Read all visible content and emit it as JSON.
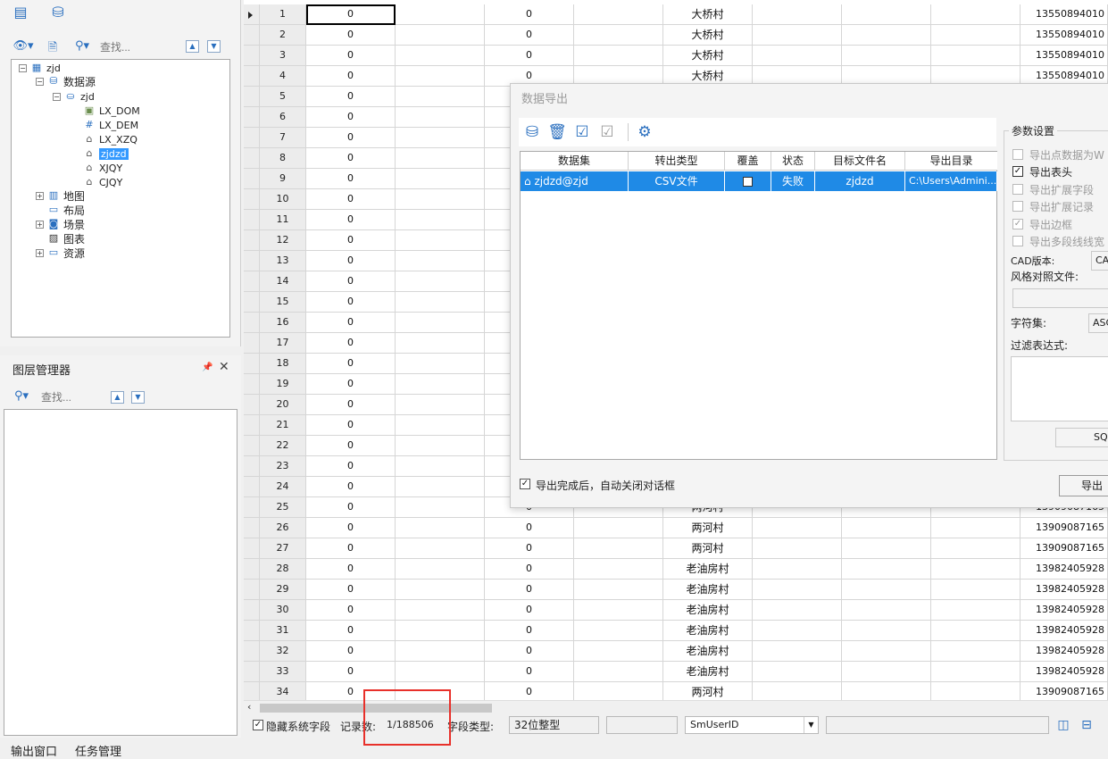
{
  "left_panel": {
    "search_placeholder": "查找...",
    "tree": {
      "root": "zjd",
      "datasource": "数据源",
      "db": "zjd",
      "datasets": [
        "LX_DOM",
        "LX_DEM",
        "LX_XZQ",
        "zjdzd",
        "XJQY",
        "CJQY"
      ],
      "selected": "zjdzd",
      "nodes": [
        "地图",
        "布局",
        "场景",
        "图表",
        "资源"
      ]
    }
  },
  "layer_manager": {
    "title": "图层管理器",
    "search_placeholder": "查找..."
  },
  "bottom_tabs": [
    "输出窗口",
    "任务管理"
  ],
  "grid": {
    "rows": [
      {
        "id": "1",
        "c1": "0",
        "c2": "0",
        "village": "大桥村",
        "phone": "13550894010"
      },
      {
        "id": "2",
        "c1": "0",
        "c2": "0",
        "village": "大桥村",
        "phone": "13550894010"
      },
      {
        "id": "3",
        "c1": "0",
        "c2": "0",
        "village": "大桥村",
        "phone": "13550894010"
      },
      {
        "id": "4",
        "c1": "0",
        "c2": "0",
        "village": "大桥村",
        "phone": "13550894010"
      },
      {
        "id": "5",
        "c1": "0",
        "c2": "",
        "village": "",
        "phone": ""
      },
      {
        "id": "6",
        "c1": "0",
        "c2": "",
        "village": "",
        "phone": ""
      },
      {
        "id": "7",
        "c1": "0",
        "c2": "",
        "village": "",
        "phone": ""
      },
      {
        "id": "8",
        "c1": "0",
        "c2": "",
        "village": "",
        "phone": ""
      },
      {
        "id": "9",
        "c1": "0",
        "c2": "",
        "village": "",
        "phone": ""
      },
      {
        "id": "10",
        "c1": "0",
        "c2": "",
        "village": "",
        "phone": ""
      },
      {
        "id": "11",
        "c1": "0",
        "c2": "",
        "village": "",
        "phone": ""
      },
      {
        "id": "12",
        "c1": "0",
        "c2": "",
        "village": "",
        "phone": ""
      },
      {
        "id": "13",
        "c1": "0",
        "c2": "",
        "village": "",
        "phone": ""
      },
      {
        "id": "14",
        "c1": "0",
        "c2": "",
        "village": "",
        "phone": ""
      },
      {
        "id": "15",
        "c1": "0",
        "c2": "",
        "village": "",
        "phone": ""
      },
      {
        "id": "16",
        "c1": "0",
        "c2": "",
        "village": "",
        "phone": ""
      },
      {
        "id": "17",
        "c1": "0",
        "c2": "",
        "village": "",
        "phone": ""
      },
      {
        "id": "18",
        "c1": "0",
        "c2": "",
        "village": "",
        "phone": ""
      },
      {
        "id": "19",
        "c1": "0",
        "c2": "",
        "village": "",
        "phone": ""
      },
      {
        "id": "20",
        "c1": "0",
        "c2": "",
        "village": "",
        "phone": ""
      },
      {
        "id": "21",
        "c1": "0",
        "c2": "",
        "village": "",
        "phone": ""
      },
      {
        "id": "22",
        "c1": "0",
        "c2": "",
        "village": "",
        "phone": ""
      },
      {
        "id": "23",
        "c1": "0",
        "c2": "",
        "village": "",
        "phone": ""
      },
      {
        "id": "24",
        "c1": "0",
        "c2": "",
        "village": "",
        "phone": ""
      },
      {
        "id": "25",
        "c1": "0",
        "c2": "0",
        "village": "两河村",
        "phone": "13909087165"
      },
      {
        "id": "26",
        "c1": "0",
        "c2": "0",
        "village": "两河村",
        "phone": "13909087165"
      },
      {
        "id": "27",
        "c1": "0",
        "c2": "0",
        "village": "两河村",
        "phone": "13909087165"
      },
      {
        "id": "28",
        "c1": "0",
        "c2": "0",
        "village": "老油房村",
        "phone": "13982405928"
      },
      {
        "id": "29",
        "c1": "0",
        "c2": "0",
        "village": "老油房村",
        "phone": "13982405928"
      },
      {
        "id": "30",
        "c1": "0",
        "c2": "0",
        "village": "老油房村",
        "phone": "13982405928"
      },
      {
        "id": "31",
        "c1": "0",
        "c2": "0",
        "village": "老油房村",
        "phone": "13982405928"
      },
      {
        "id": "32",
        "c1": "0",
        "c2": "0",
        "village": "老油房村",
        "phone": "13982405928"
      },
      {
        "id": "33",
        "c1": "0",
        "c2": "0",
        "village": "老油房村",
        "phone": "13982405928"
      },
      {
        "id": "34",
        "c1": "0",
        "c2": "0",
        "village": "两河村",
        "phone": "13909087165"
      }
    ]
  },
  "status_bar": {
    "hide_system_fields": "隐藏系统字段",
    "record_label": "记录数:",
    "record_value": "1/188506",
    "field_type_label": "字段类型:",
    "field_type_value": "32位整型",
    "field_name": "SmUserID"
  },
  "dialog": {
    "title": "数据导出",
    "table_headers": [
      "数据集",
      "转出类型",
      "覆盖",
      "状态",
      "目标文件名",
      "导出目录"
    ],
    "row": {
      "dataset": "zjdzd@zjd",
      "type": "CSV文件",
      "status": "失败",
      "target": "zjdzd",
      "dir": "C:\\Users\\Admini..."
    },
    "auto_close": "导出完成后，自动关闭对话框",
    "export_button": "导出",
    "params": {
      "title": "参数设置",
      "options": [
        "导出点数据为W",
        "导出表头",
        "导出扩展字段",
        "导出扩展记录",
        "导出边框",
        "导出多段线线宽"
      ],
      "cad_version_label": "CAD版本:",
      "cad_version_value": "CA",
      "style_file_label": "风格对照文件:",
      "charset_label": "字符集:",
      "charset_value": "ASC",
      "filter_label": "过滤表达式:",
      "sql_button": "SQL"
    }
  },
  "colors": {
    "accent": "#1f8ae6",
    "highlight_red": "#e8302a"
  }
}
